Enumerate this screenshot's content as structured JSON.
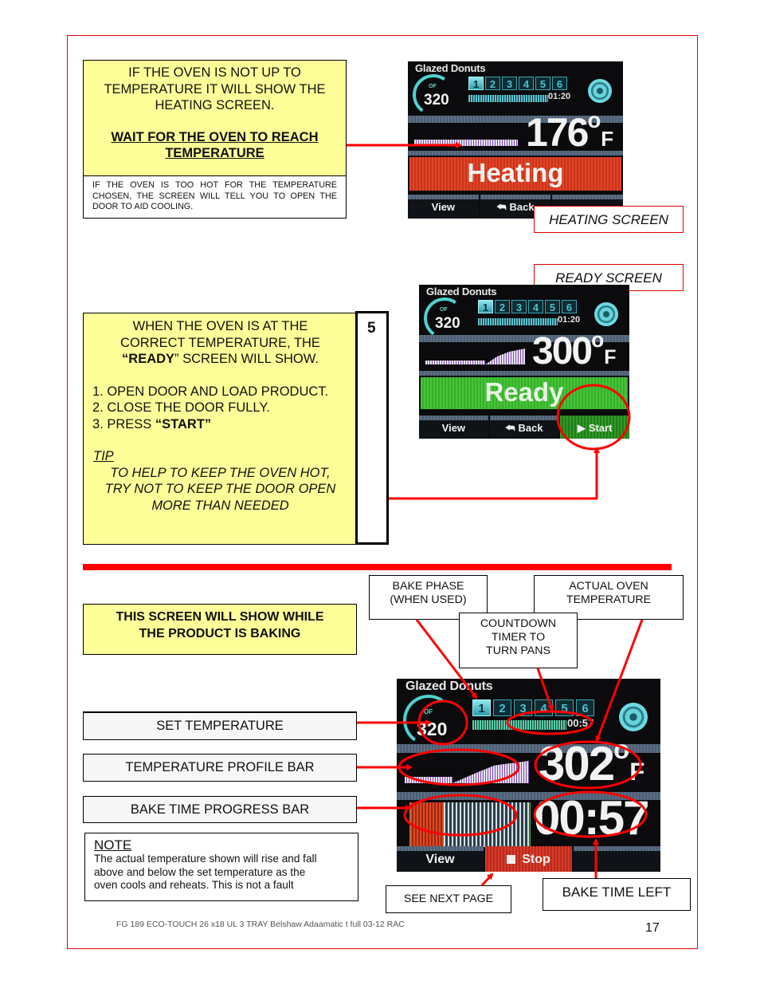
{
  "page": {
    "footer": "FG 189 ECO-TOUCH 26 x18 UL 3 TRAY Belshaw Adaamatic t full 03-12 RAC",
    "page_number": "17",
    "step_number": "5"
  },
  "heating_section": {
    "instruction_lines": [
      "IF THE OVEN IS NOT UP TO",
      "TEMPERATURE IT WILL SHOW THE",
      "HEATING SCREEN."
    ],
    "emphasis_lines": [
      "WAIT FOR THE OVEN TO REACH",
      "TEMPERATURE"
    ],
    "note": "IF THE OVEN IS TOO HOT FOR THE TEMPERATURE CHOSEN, THE SCREEN WILL TELL YOU TO OPEN THE DOOR TO AID COOLING.",
    "caption": "HEATING SCREEN"
  },
  "ready_section": {
    "caption": "READY SCREEN",
    "intro_lines": [
      "WHEN THE OVEN IS AT THE",
      "CORRECT TEMPERATURE, THE"
    ],
    "intro_ready_quote_open": "“",
    "intro_ready_word": "READY",
    "intro_ready_rest": "” SCREEN WILL SHOW.",
    "steps": [
      "1. OPEN DOOR AND LOAD PRODUCT.",
      "2. CLOSE THE DOOR FULLY.",
      "3. PRESS "
    ],
    "step3_bold": "“START”",
    "tip_label": "TIP",
    "tip_lines": [
      "TO HELP TO KEEP THE OVEN HOT,",
      "TRY NOT TO KEEP THE DOOR OPEN",
      "MORE THAN NEEDED"
    ]
  },
  "baking_section": {
    "heading_lines": [
      "THIS SCREEN WILL SHOW WHILE",
      "THE PRODUCT IS BAKING"
    ],
    "labels": {
      "set_temperature": "SET TEMPERATURE",
      "temperature_profile_bar": "TEMPERATURE PROFILE BAR",
      "bake_time_progress_bar": "BAKE TIME PROGRESS BAR",
      "bake_phase": [
        "BAKE PHASE",
        "(WHEN USED)"
      ],
      "actual_oven_temperature": [
        "ACTUAL OVEN",
        "TEMPERATURE"
      ],
      "countdown_timer": [
        "COUNTDOWN",
        "TIMER TO",
        "TURN PANS"
      ],
      "see_next_page": "SEE NEXT PAGE",
      "bake_time_left": "BAKE TIME LEFT"
    },
    "note_title": "NOTE",
    "note_lines": [
      "The actual temperature shown will rise and fall",
      "above and below the set temperature as the",
      "oven cools and reheats. This is not a fault"
    ]
  },
  "screens": {
    "heating": {
      "product": "Glazed Donuts",
      "unit": "OF",
      "set_temp": "320",
      "phases": [
        "1",
        "2",
        "3",
        "4",
        "5",
        "6"
      ],
      "active_phase": "1",
      "pan_timer": "01:20",
      "actual_temp": "176",
      "degree": "o",
      "temp_unit": "F",
      "status": "Heating",
      "buttons": [
        "View",
        "Back",
        ""
      ]
    },
    "ready": {
      "product": "Glazed Donuts",
      "unit": "OF",
      "set_temp": "320",
      "phases": [
        "1",
        "2",
        "3",
        "4",
        "5",
        "6"
      ],
      "active_phase": "1",
      "pan_timer": "01:20",
      "actual_temp": "300",
      "degree": "o",
      "temp_unit": "F",
      "status": "Ready",
      "buttons": [
        "View",
        "Back",
        "Start"
      ]
    },
    "baking": {
      "product": "Glazed Donuts",
      "unit": "OF",
      "set_temp": "320",
      "phases": [
        "1",
        "2",
        "3",
        "4",
        "5",
        "6"
      ],
      "active_phase": "1",
      "pan_timer": "00:57",
      "actual_temp": "302",
      "degree": "o",
      "temp_unit": "F",
      "bake_time_left": "00:57",
      "bake_progress_percent": 28,
      "buttons": [
        "View",
        "Stop",
        ""
      ]
    }
  },
  "colors": {
    "accent_red": "#e00000",
    "note_yellow": "#ffff99",
    "heating_red": "#d83c22",
    "ready_green": "#3fbb33",
    "screen_teal": "#4fd2cf"
  }
}
